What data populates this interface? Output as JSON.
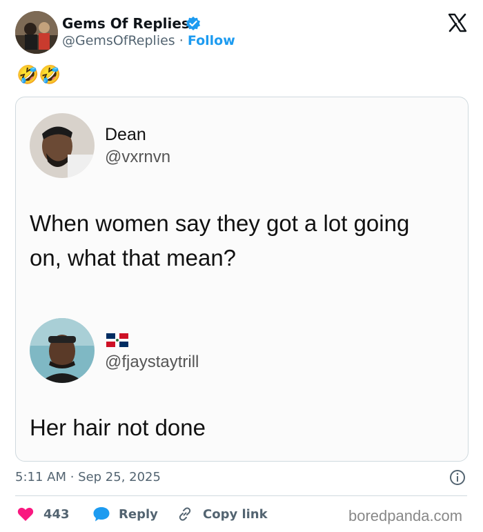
{
  "tweet": {
    "author_name": "Gems Of Replies",
    "author_handle": "@GemsOfReplies",
    "separator": "·",
    "follow_label": "Follow",
    "text": "🤣🤣",
    "timestamp": "5:11 AM · Sep 25, 2025"
  },
  "screenshot": {
    "post": {
      "name": "Dean",
      "handle": "@vxrnvn",
      "text": "When women say they got a lot going on, what that mean?"
    },
    "reply": {
      "handle": "@fjaystaytrill",
      "text": "Her hair not done"
    }
  },
  "actions": {
    "likes": "443",
    "reply_label": "Reply",
    "copy_label": "Copy link"
  },
  "watermark": "boredpanda.com",
  "colors": {
    "accent": "#1d9bf0",
    "like": "#f91880",
    "reply_icon": "#1d9bf0"
  }
}
